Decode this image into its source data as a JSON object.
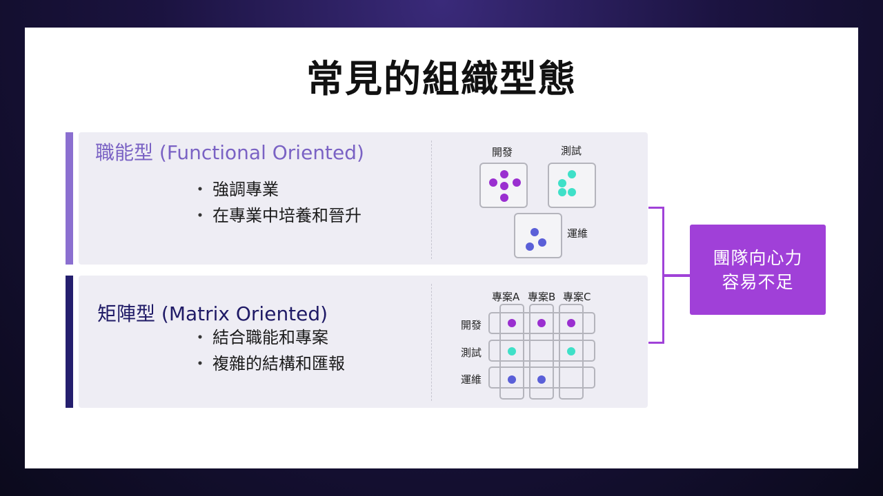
{
  "slide": {
    "title": "常見的組織型態"
  },
  "functional": {
    "heading": "職能型 (Functional Oriented)",
    "bullets": [
      "強調專業",
      "在專業中培養和晉升"
    ],
    "diagram": {
      "labels": {
        "dev": "開發",
        "test": "測試",
        "ops": "運維"
      }
    }
  },
  "matrix": {
    "heading": "矩陣型 (Matrix Oriented)",
    "bullets": [
      "結合職能和專案",
      "複雜的結構和匯報"
    ],
    "diagram": {
      "columns": [
        "專案A",
        "專案B",
        "專案C"
      ],
      "rows": [
        "開發",
        "測試",
        "運維"
      ]
    }
  },
  "callout": {
    "line1": "團隊向心力",
    "line2": "容易不足"
  },
  "colors": {
    "functional_accent": "#8b6fd0",
    "matrix_accent": "#251f6e",
    "dev_dot": "#9a2fd0",
    "test_dot": "#3fe0c8",
    "ops_dot": "#5a5fd8",
    "callout_bg": "#a040d8"
  }
}
